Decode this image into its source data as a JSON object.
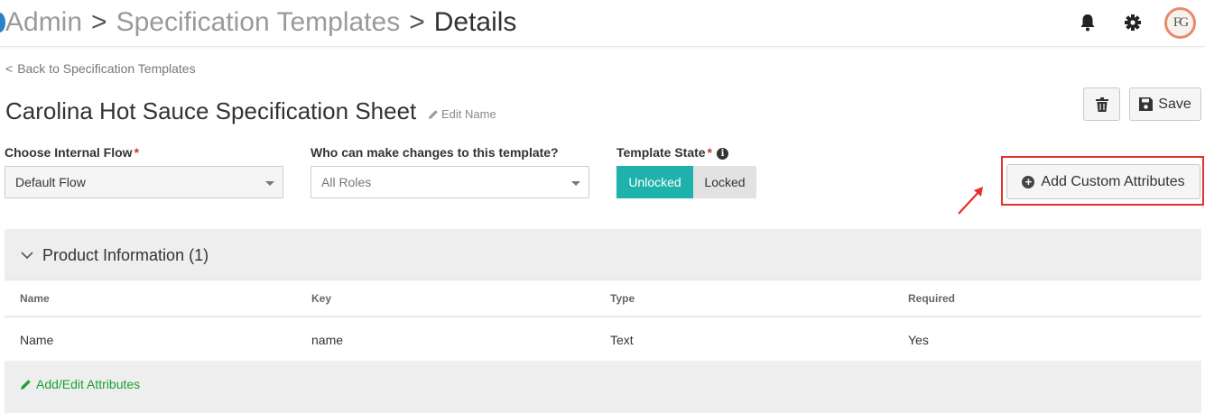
{
  "header": {
    "breadcrumbs": [
      "Admin",
      "Specification Templates",
      "Details"
    ],
    "separator": ">",
    "avatar_initials": "FG",
    "icons": [
      "bell-icon",
      "gear-icon"
    ]
  },
  "back_link": {
    "chevron": "<",
    "label": "Back to Specification Templates"
  },
  "template": {
    "title": "Carolina Hot Sauce Specification Sheet",
    "edit_name_label": "Edit Name"
  },
  "actions": {
    "save_label": "Save",
    "add_custom_attributes_label": "Add Custom Attributes"
  },
  "fields": {
    "internal_flow": {
      "label": "Choose Internal Flow",
      "required_mark": "*",
      "value": "Default Flow"
    },
    "roles": {
      "label": "Who can make changes to this template?",
      "placeholder": "All Roles"
    },
    "template_state": {
      "label": "Template State",
      "required_mark": "*",
      "info_glyph": "i",
      "options": [
        "Unlocked",
        "Locked"
      ],
      "selected": "Unlocked"
    }
  },
  "section": {
    "title": "Product Information (1)",
    "columns": [
      "Name",
      "Key",
      "Type",
      "Required"
    ],
    "rows": [
      {
        "name": "Name",
        "key": "name",
        "type": "Text",
        "required": "Yes"
      }
    ],
    "add_edit_label": "Add/Edit Attributes"
  },
  "colors": {
    "accent_teal": "#1fb2ac",
    "link_green": "#1aa133",
    "highlight_red": "#e3312b",
    "required_red": "#c0392b"
  }
}
